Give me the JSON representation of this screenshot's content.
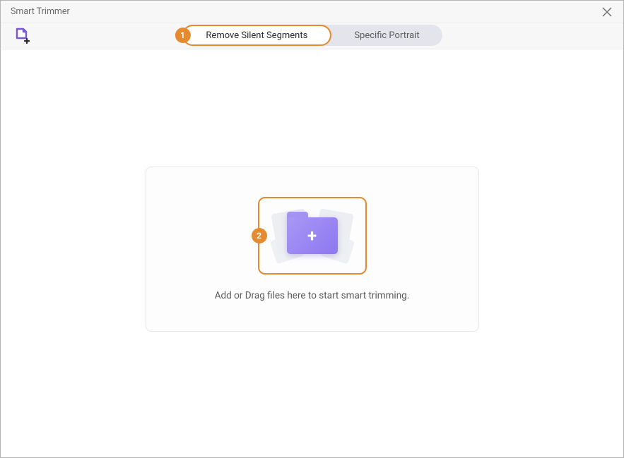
{
  "window": {
    "title": "Smart Trimmer"
  },
  "tabs": {
    "remove_silent": "Remove Silent Segments",
    "specific_portrait": "Specific Portrait"
  },
  "steps": {
    "one": "1",
    "two": "2"
  },
  "dropzone": {
    "text": "Add or Drag files here to start smart trimming."
  },
  "colors": {
    "accent_orange": "#e58a2e",
    "accent_purple": "#8d77ef"
  }
}
